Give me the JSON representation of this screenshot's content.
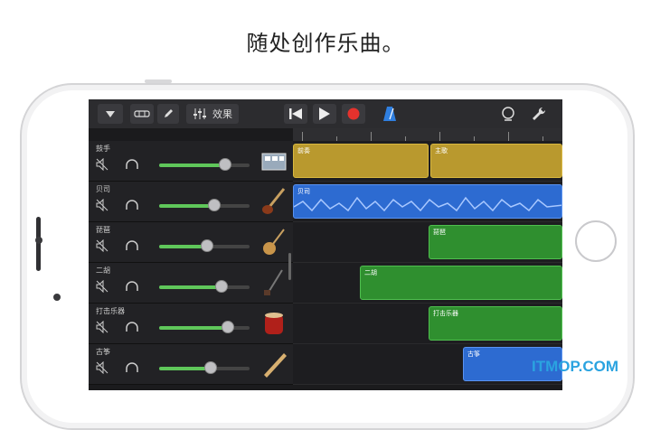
{
  "caption": "随处创作乐曲。",
  "toolbar": {
    "menu_icon": "dropdown-triangle-icon",
    "tracks_icon": "tracks-view-icon",
    "pencil_icon": "pencil-icon",
    "mixer_icon": "mixer-icon",
    "effects_label": "效果",
    "rewind_icon": "rewind-icon",
    "play_icon": "play-icon",
    "record_icon": "record-icon",
    "metronome_icon": "metronome-icon",
    "loop_icon": "loop-icon",
    "settings_icon": "wrench-icon"
  },
  "tracks": [
    {
      "name": "鼓手",
      "volume": 0.72,
      "instrument": "drum-machine-icon",
      "region_color": "#b9992e"
    },
    {
      "name": "贝司",
      "volume": 0.6,
      "instrument": "bass-guitar-icon",
      "region_color": "#2d6bd1"
    },
    {
      "name": "琵琶",
      "volume": 0.52,
      "instrument": "pipa-icon",
      "region_color": "#2f8f2f"
    },
    {
      "name": "二胡",
      "volume": 0.68,
      "instrument": "erhu-icon",
      "region_color": "#2f8f2f"
    },
    {
      "name": "打击乐器",
      "volume": 0.75,
      "instrument": "chinese-drum-icon",
      "region_color": "#2f8f2f"
    },
    {
      "name": "古筝",
      "volume": 0.56,
      "instrument": "guzheng-icon",
      "region_color": "#2d6bd1"
    }
  ],
  "regions": {
    "drums_a": "前奏",
    "drums_b": "主歌",
    "bass": "贝司",
    "pipa": "琵琶",
    "erhu": "二胡",
    "perc": "打击乐器",
    "guzheng": "古筝"
  },
  "watermark": "ITMOP.COM"
}
